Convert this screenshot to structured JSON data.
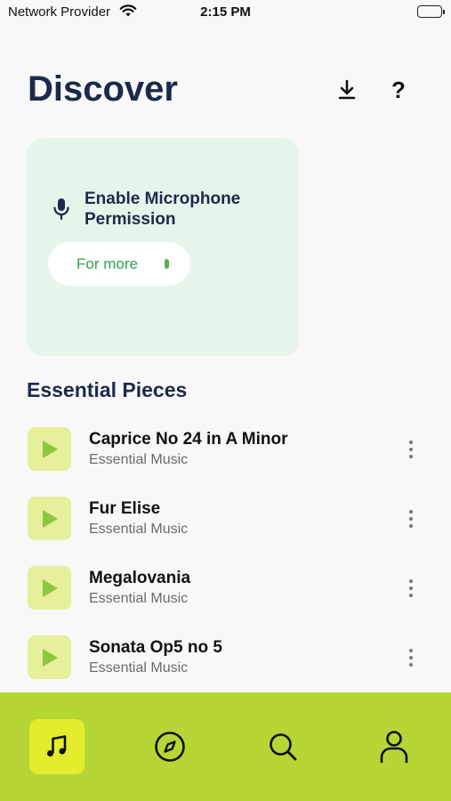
{
  "status_bar": {
    "carrier": "Network Provider",
    "time": "2:15 PM"
  },
  "header": {
    "title": "Discover",
    "help_label": "?"
  },
  "mic_card": {
    "text": "Enable Microphone Permission",
    "button_label": "For more"
  },
  "section": {
    "title": "Essential Pieces"
  },
  "tracks": [
    {
      "title": "Caprice No 24 in A Minor",
      "subtitle": "Essential Music"
    },
    {
      "title": "Fur Elise",
      "subtitle": "Essential Music"
    },
    {
      "title": "Megalovania",
      "subtitle": "Essential Music"
    },
    {
      "title": "Sonata Op5 no 5",
      "subtitle": "Essential Music"
    }
  ],
  "tab_bar": {
    "tabs": [
      {
        "icon": "music-note-icon",
        "active": true
      },
      {
        "icon": "compass-icon",
        "active": false
      },
      {
        "icon": "search-icon",
        "active": false
      },
      {
        "icon": "profile-icon",
        "active": false
      }
    ]
  },
  "colors": {
    "accent": "#b5d635",
    "active_tab": "#e4ed2c",
    "card_bg": "#e6f5ea",
    "thumb_bg": "#e6ef9a",
    "title": "#1b2a4a",
    "link_green": "#2fa34a"
  }
}
